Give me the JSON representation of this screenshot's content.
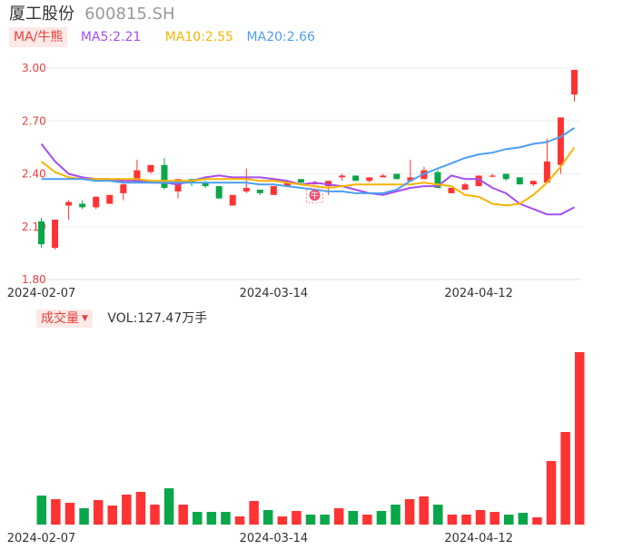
{
  "stock": {
    "name": "厦工股份",
    "code": "600815.SH"
  },
  "legend": {
    "ma_toggle": "MA/牛熊",
    "ma5": "MA5:2.21",
    "ma10": "MA10:2.55",
    "ma20": "MA20:2.66"
  },
  "volume_legend": {
    "toggle": "成交量",
    "arrow": "▼",
    "value": "VOL:127.47万手"
  },
  "marker": {
    "label": "牛"
  },
  "colors": {
    "up": "#ff3333",
    "down": "#0aa64a",
    "ma5": "#a64df0",
    "ma10": "#f7b500",
    "ma20": "#4d9ef0",
    "accent": "#e6413c"
  },
  "chart_data": {
    "type": "candlestick",
    "y_axis": {
      "ticks": [
        3.0,
        2.7,
        2.4,
        2.1,
        1.8
      ],
      "tick_labels": [
        "3.00",
        "2.70",
        "2.40",
        "2.10",
        "1.80"
      ],
      "ylim": [
        1.8,
        3.0
      ]
    },
    "x_axis": {
      "tick_labels": [
        "2024-02-07",
        "2024-03-14",
        "2024-04-12"
      ],
      "tick_indices": [
        0,
        17,
        32
      ]
    },
    "candles": [
      {
        "o": 2.13,
        "c": 2.0,
        "h": 2.15,
        "l": 1.98
      },
      {
        "o": 1.98,
        "c": 2.14,
        "h": 2.14,
        "l": 1.97
      },
      {
        "o": 2.22,
        "c": 2.24,
        "h": 2.25,
        "l": 2.14
      },
      {
        "o": 2.23,
        "c": 2.21,
        "h": 2.25,
        "l": 2.2
      },
      {
        "o": 2.21,
        "c": 2.27,
        "h": 2.27,
        "l": 2.2
      },
      {
        "o": 2.23,
        "c": 2.28,
        "h": 2.28,
        "l": 2.23
      },
      {
        "o": 2.29,
        "c": 2.34,
        "h": 2.35,
        "l": 2.25
      },
      {
        "o": 2.36,
        "c": 2.42,
        "h": 2.48,
        "l": 2.35
      },
      {
        "o": 2.41,
        "c": 2.45,
        "h": 2.45,
        "l": 2.4
      },
      {
        "o": 2.45,
        "c": 2.32,
        "h": 2.49,
        "l": 2.31
      },
      {
        "o": 2.3,
        "c": 2.37,
        "h": 2.37,
        "l": 2.26
      },
      {
        "o": 2.37,
        "c": 2.35,
        "h": 2.37,
        "l": 2.33
      },
      {
        "o": 2.35,
        "c": 2.33,
        "h": 2.36,
        "l": 2.32
      },
      {
        "o": 2.33,
        "c": 2.26,
        "h": 2.33,
        "l": 2.26
      },
      {
        "o": 2.22,
        "c": 2.28,
        "h": 2.28,
        "l": 2.22
      },
      {
        "o": 2.3,
        "c": 2.32,
        "h": 2.43,
        "l": 2.29
      },
      {
        "o": 2.31,
        "c": 2.29,
        "h": 2.31,
        "l": 2.28
      },
      {
        "o": 2.28,
        "c": 2.33,
        "h": 2.33,
        "l": 2.28
      },
      {
        "o": 2.33,
        "c": 2.36,
        "h": 2.36,
        "l": 2.33
      },
      {
        "o": 2.37,
        "c": 2.35,
        "h": 2.37,
        "l": 2.34
      },
      {
        "o": 2.34,
        "c": 2.35,
        "h": 2.36,
        "l": 2.34
      },
      {
        "o": 2.33,
        "c": 2.36,
        "h": 2.36,
        "l": 2.28
      },
      {
        "o": 2.38,
        "c": 2.39,
        "h": 2.4,
        "l": 2.36
      },
      {
        "o": 2.39,
        "c": 2.36,
        "h": 2.39,
        "l": 2.36
      },
      {
        "o": 2.36,
        "c": 2.38,
        "h": 2.38,
        "l": 2.35
      },
      {
        "o": 2.38,
        "c": 2.39,
        "h": 2.4,
        "l": 2.38
      },
      {
        "o": 2.4,
        "c": 2.37,
        "h": 2.4,
        "l": 2.37
      },
      {
        "o": 2.36,
        "c": 2.38,
        "h": 2.48,
        "l": 2.36
      },
      {
        "o": 2.37,
        "c": 2.42,
        "h": 2.44,
        "l": 2.37
      },
      {
        "o": 2.41,
        "c": 2.32,
        "h": 2.42,
        "l": 2.32
      },
      {
        "o": 2.29,
        "c": 2.32,
        "h": 2.32,
        "l": 2.29
      },
      {
        "o": 2.31,
        "c": 2.34,
        "h": 2.35,
        "l": 2.31
      },
      {
        "o": 2.33,
        "c": 2.39,
        "h": 2.39,
        "l": 2.33
      },
      {
        "o": 2.39,
        "c": 2.39,
        "h": 2.4,
        "l": 2.38
      },
      {
        "o": 2.4,
        "c": 2.37,
        "h": 2.4,
        "l": 2.36
      },
      {
        "o": 2.38,
        "c": 2.34,
        "h": 2.38,
        "l": 2.34
      },
      {
        "o": 2.34,
        "c": 2.36,
        "h": 2.36,
        "l": 2.33
      },
      {
        "o": 2.35,
        "c": 2.47,
        "h": 2.6,
        "l": 2.35
      },
      {
        "o": 2.45,
        "c": 2.72,
        "h": 2.72,
        "l": 2.4
      },
      {
        "o": 2.85,
        "c": 2.99,
        "h": 2.99,
        "l": 2.81
      }
    ],
    "ma5": [
      2.57,
      2.47,
      2.4,
      2.38,
      2.37,
      2.37,
      2.36,
      2.36,
      2.35,
      2.35,
      2.34,
      2.36,
      2.38,
      2.39,
      2.38,
      2.38,
      2.38,
      2.37,
      2.36,
      2.34,
      2.35,
      2.34,
      2.33,
      2.31,
      2.29,
      2.28,
      2.3,
      2.32,
      2.33,
      2.33,
      2.39,
      2.37,
      2.37,
      2.32,
      2.29,
      2.23,
      2.2,
      2.17,
      2.17,
      2.21
    ],
    "ma10": [
      2.47,
      2.41,
      2.38,
      2.37,
      2.37,
      2.37,
      2.37,
      2.37,
      2.36,
      2.36,
      2.36,
      2.36,
      2.37,
      2.37,
      2.37,
      2.37,
      2.36,
      2.36,
      2.35,
      2.34,
      2.33,
      2.32,
      2.33,
      2.34,
      2.34,
      2.34,
      2.34,
      2.34,
      2.35,
      2.34,
      2.33,
      2.28,
      2.27,
      2.23,
      2.22,
      2.23,
      2.28,
      2.35,
      2.44,
      2.55
    ],
    "ma20": [
      2.37,
      2.37,
      2.37,
      2.37,
      2.36,
      2.36,
      2.35,
      2.35,
      2.35,
      2.35,
      2.35,
      2.35,
      2.35,
      2.35,
      2.35,
      2.35,
      2.34,
      2.34,
      2.33,
      2.32,
      2.31,
      2.3,
      2.3,
      2.29,
      2.29,
      2.29,
      2.31,
      2.36,
      2.4,
      2.43,
      2.46,
      2.49,
      2.51,
      2.52,
      2.54,
      2.55,
      2.57,
      2.58,
      2.61,
      2.66
    ],
    "marker_index": 20,
    "volume": [
      32,
      28,
      24,
      18,
      27,
      21,
      33,
      36,
      22,
      40,
      22,
      14,
      14,
      14,
      9,
      26,
      16,
      9,
      15,
      11,
      11,
      18,
      15,
      11,
      15,
      22,
      28,
      31,
      22,
      11,
      11,
      16,
      14,
      11,
      13,
      8,
      70,
      102,
      190
    ],
    "volume_up": [
      false,
      true,
      true,
      false,
      true,
      true,
      true,
      true,
      true,
      false,
      true,
      false,
      false,
      false,
      true,
      true,
      false,
      true,
      true,
      false,
      false,
      true,
      false,
      true,
      false,
      false,
      true,
      true,
      false,
      true,
      true,
      true,
      true,
      false,
      false,
      true,
      true,
      true,
      true
    ],
    "volume_label": "VOL:127.47万手"
  }
}
